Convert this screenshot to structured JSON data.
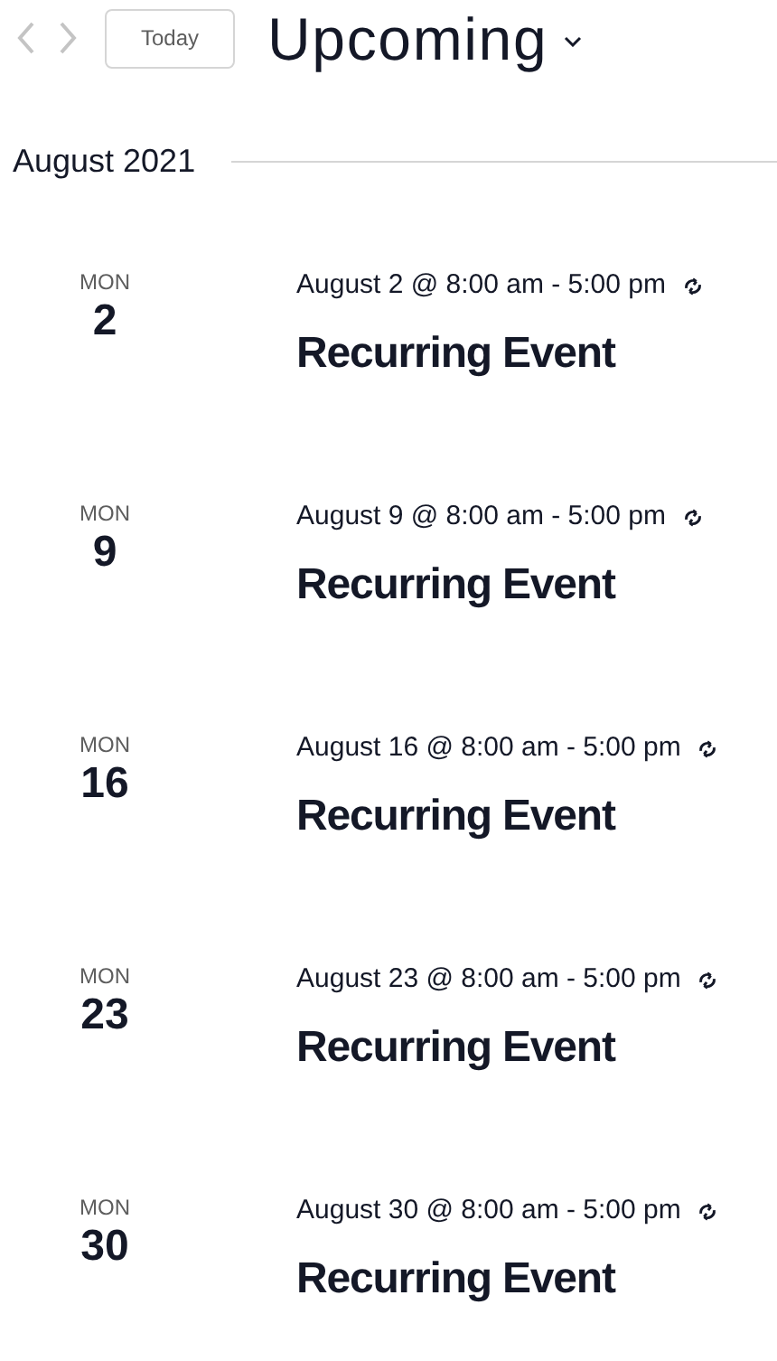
{
  "nav": {
    "today": "Today",
    "title": "Upcoming"
  },
  "month": "August 2021",
  "events": [
    {
      "weekday": "MON",
      "day": "2",
      "time": "August 2 @ 8:00 am - 5:00 pm",
      "title": "Recurring Event"
    },
    {
      "weekday": "MON",
      "day": "9",
      "time": "August 9 @ 8:00 am - 5:00 pm",
      "title": "Recurring Event"
    },
    {
      "weekday": "MON",
      "day": "16",
      "time": "August 16 @ 8:00 am - 5:00 pm",
      "title": "Recurring Event"
    },
    {
      "weekday": "MON",
      "day": "23",
      "time": "August 23 @ 8:00 am - 5:00 pm",
      "title": "Recurring Event"
    },
    {
      "weekday": "MON",
      "day": "30",
      "time": "August 30 @ 8:00 am - 5:00 pm",
      "title": "Recurring Event"
    }
  ]
}
